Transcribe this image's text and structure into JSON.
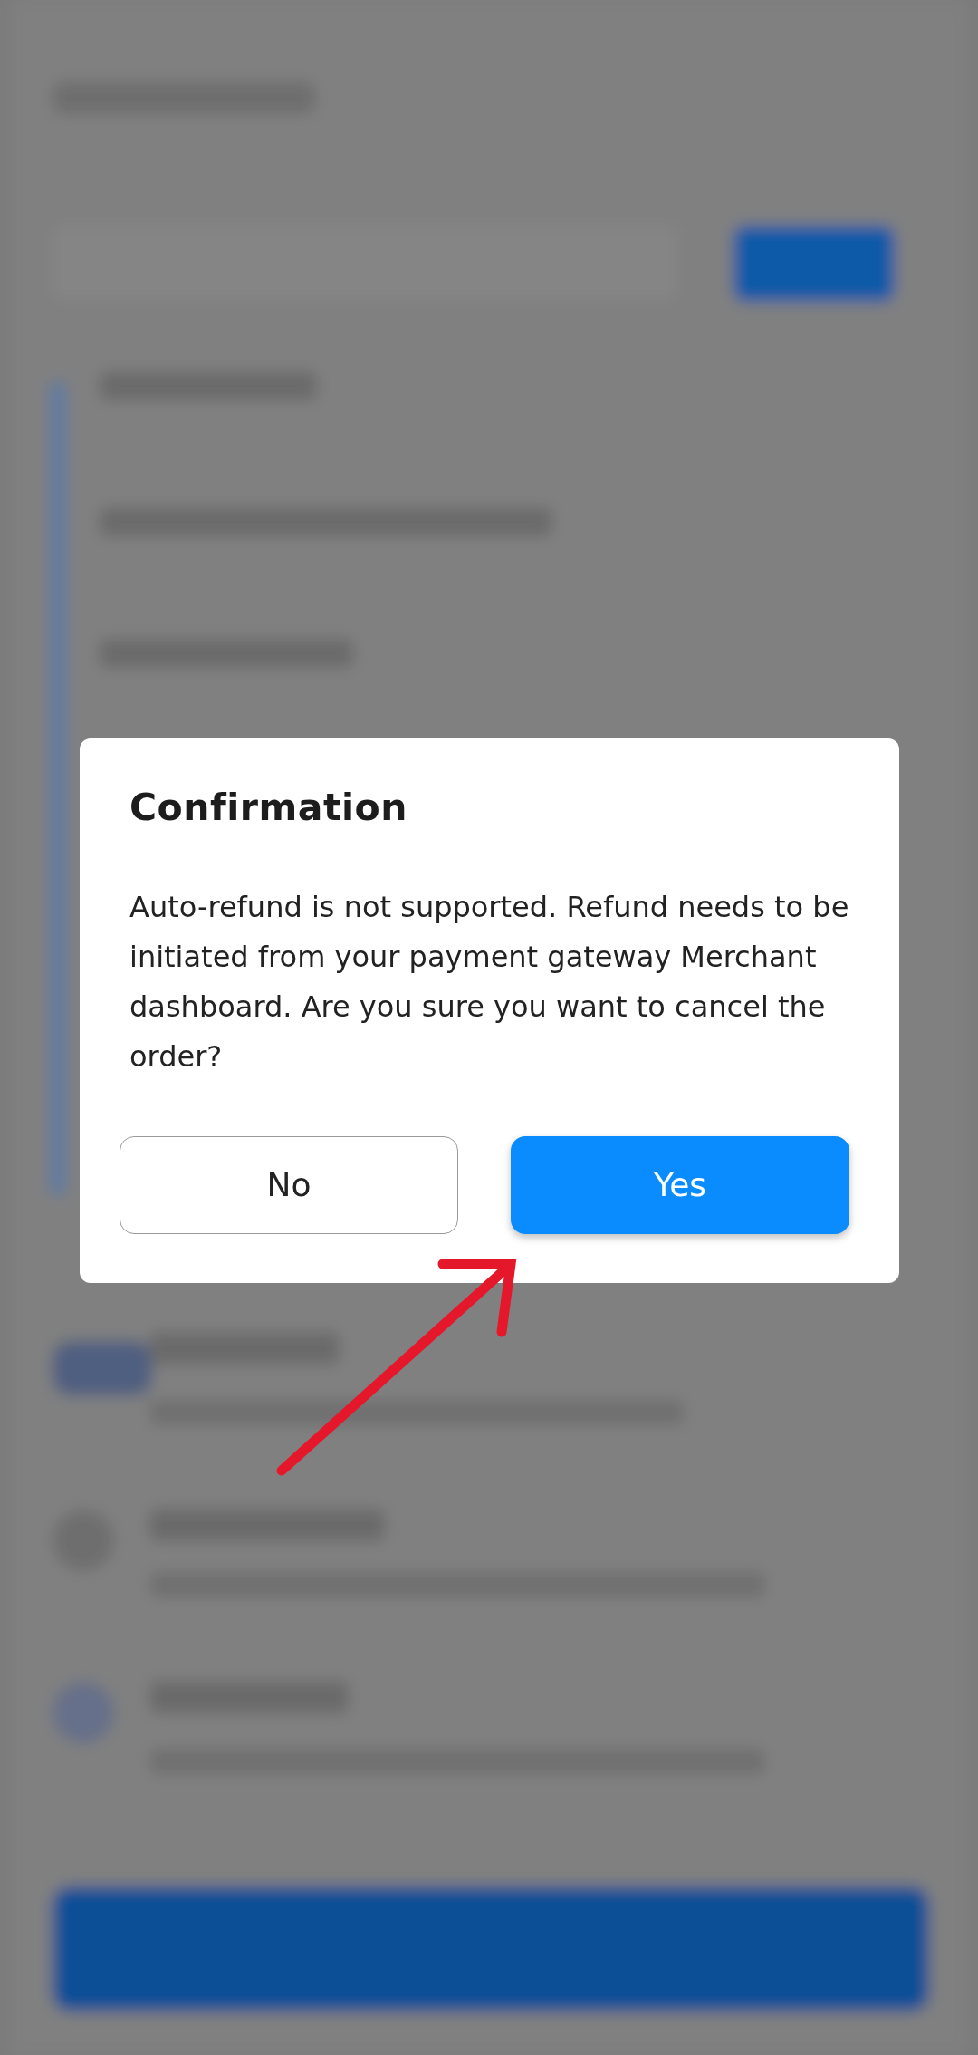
{
  "dialog": {
    "title": "Confirmation",
    "message": "Auto-refund is not supported. Refund needs to be initiated from your payment gateway Merchant dashboard. Are you sure you want to cancel the order?",
    "buttons": [
      {
        "label": "No",
        "kind": "secondary"
      },
      {
        "label": "Yes",
        "kind": "primary"
      }
    ]
  }
}
